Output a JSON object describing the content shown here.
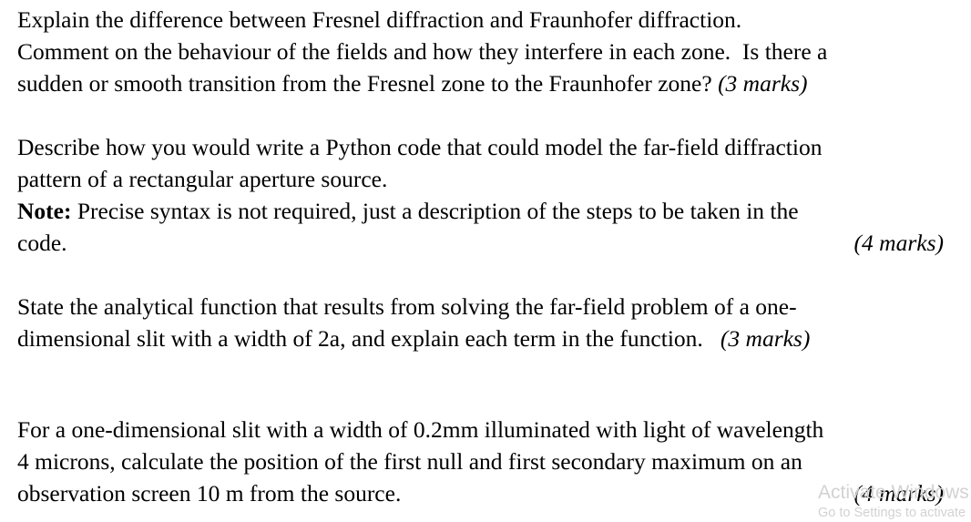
{
  "document": {
    "background_color": "#ffffff",
    "text_color": "#000000",
    "paragraphs": [
      {
        "id": "p1",
        "lines": [
          "Explain the difference between Fresnel diffraction and Fraunhofer diffraction.",
          "Comment on the behaviour of the fields and how they interfere in each zone.  Is there a",
          "sudden or smooth transition from the Fresnel zone to the Fraunhofer zone? "
        ],
        "marks": "(3 marks)",
        "marks_inline": true
      },
      {
        "id": "p2",
        "lines": [
          "Describe how you would write a Python code that could model the far-field diffraction",
          "pattern of a rectangular aperture source.",
          "Precise syntax is not required, just a description of the steps to be taken in the",
          "code."
        ],
        "note_label": "Note:",
        "marks": "(4 marks)",
        "marks_inline": false
      },
      {
        "id": "p3",
        "lines": [
          "State the analytical function that results from solving the far-field problem of a one-",
          "dimensional slit with a width of 2a, and explain each term in the function.   "
        ],
        "marks": "(3 marks)",
        "marks_inline": true
      },
      {
        "id": "p4",
        "lines": [
          "For a one-dimensional slit with a width of 0.2mm illuminated with light of wavelength",
          "4 microns, calculate the position of the first null and first secondary maximum on an",
          "observation screen 10 m from the source."
        ],
        "marks": "(4 marks)",
        "marks_inline": false
      }
    ]
  },
  "watermark": {
    "title": "Activate Windows",
    "subtitle": "Go to Settings to activate",
    "color": "#d2d2d2"
  }
}
